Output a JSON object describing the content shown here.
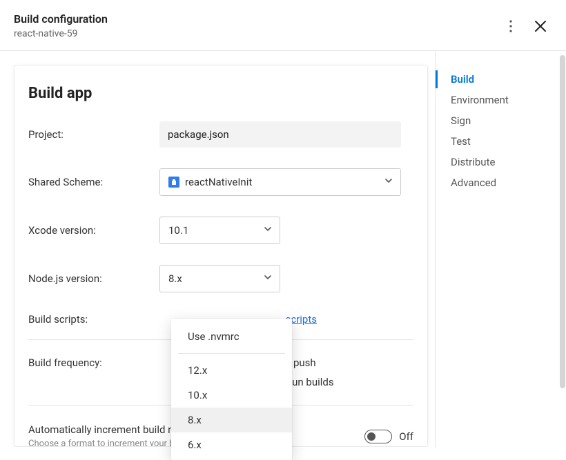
{
  "header": {
    "title": "Build configuration",
    "subtitle": "react-native-59"
  },
  "section_title": "Build app",
  "fields": {
    "project_label": "Project:",
    "project_value": "package.json",
    "scheme_label": "Shared Scheme:",
    "scheme_value": "reactNativeInit",
    "xcode_label": "Xcode version:",
    "xcode_value": "10.1",
    "node_label": "Node.js version:",
    "node_value": "8.x",
    "scripts_label": "Build scripts:",
    "scripts_link": "scripts",
    "freq_label": "Build frequency:",
    "freq_opt1": "ery push",
    "freq_opt2": "to run builds",
    "auto_title": "Automatically increment build number",
    "auto_sub": "Choose a format to increment your builds.",
    "auto_state": "Off"
  },
  "node_dropdown": {
    "top_option": "Use .nvmrc",
    "options": [
      "12.x",
      "10.x",
      "8.x",
      "6.x"
    ],
    "selected": "8.x"
  },
  "nav": {
    "items": [
      "Build",
      "Environment",
      "Sign",
      "Test",
      "Distribute",
      "Advanced"
    ],
    "active": "Build"
  }
}
